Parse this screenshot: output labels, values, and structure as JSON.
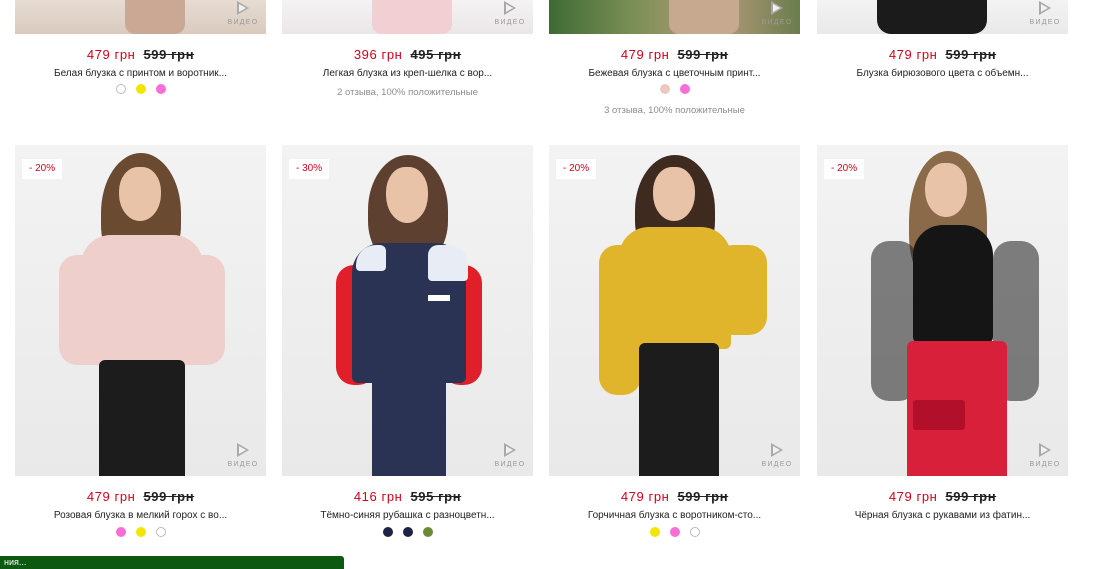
{
  "video_label": "ВИДЕО",
  "row1": [
    {
      "price_new": "479 грн",
      "price_old": "599 грн",
      "name": "Белая блузка с принтом и воротник...",
      "swatches": [
        "#ffffff",
        "#f2e600",
        "#f76ed6"
      ],
      "reviews": ""
    },
    {
      "price_new": "396 грн",
      "price_old": "495 грн",
      "name": "Легкая блузка из креп-шелка с вор...",
      "swatches": [],
      "reviews": "2 отзыва, 100% положительные"
    },
    {
      "price_new": "479 грн",
      "price_old": "599 грн",
      "name": "Бежевая блузка с цветочным принт...",
      "swatches": [
        "#ecc8bd",
        "#f76ed6"
      ],
      "reviews": "3 отзыва, 100% положительные"
    },
    {
      "price_new": "479 грн",
      "price_old": "599 грн",
      "name": "Блузка бирюзового цвета с объемн...",
      "swatches": [],
      "reviews": ""
    }
  ],
  "row2": [
    {
      "badge": "- 20%",
      "price_new": "479 грн",
      "price_old": "599 грн",
      "name": "Розовая блузка в мелкий горох с во...",
      "swatches": [
        "#f76ed6",
        "#f2e600",
        "#ffffff"
      ],
      "top_color": "#efcfcb",
      "legs_color": "#1c1c1c",
      "hair_color": "#6b4a32"
    },
    {
      "badge": "- 30%",
      "price_new": "416 грн",
      "price_old": "595 грн",
      "name": "Тёмно-синяя рубашка с разноцветн...",
      "swatches": [
        "#1e2245",
        "#1e2245",
        "#6b8a35"
      ],
      "top_color": "#2b3355",
      "legs_color": "#2b3355",
      "hair_color": "#5e4030"
    },
    {
      "badge": "- 20%",
      "price_new": "479 грн",
      "price_old": "599 грн",
      "name": "Горчичная блузка с воротником-сто...",
      "swatches": [
        "#f2e600",
        "#f76ed6",
        "#ffffff"
      ],
      "top_color": "#e0b52c",
      "legs_color": "#1c1c1c",
      "hair_color": "#3e2a1e"
    },
    {
      "badge": "- 20%",
      "price_new": "479 грн",
      "price_old": "599 грн",
      "name": "Чёрная блузка с рукавами из фатин...",
      "swatches": [],
      "top_color": "#151515",
      "legs_color": "#d8203a",
      "hair_color": "#8a6a48"
    }
  ],
  "greenbar_text": "ния..."
}
